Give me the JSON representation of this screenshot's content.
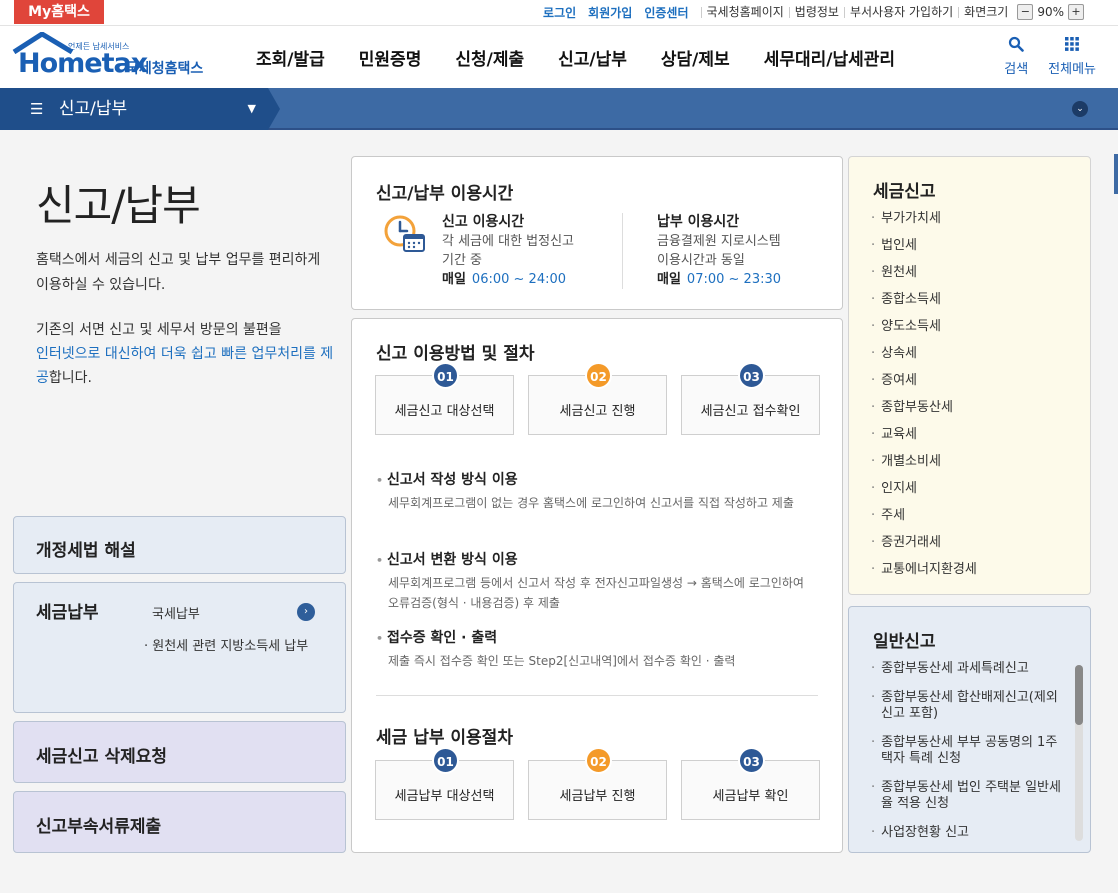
{
  "topbar": {
    "my_tab": "My홈택스",
    "login": "로그인",
    "signup": "회원가입",
    "cert_center": "인증센터",
    "links": [
      "국세청홈페이지",
      "법령정보",
      "부서사용자 가입하기"
    ],
    "zoom_label": "화면크기",
    "zoom_minus": "−",
    "zoom_value": "90%",
    "zoom_plus": "+"
  },
  "header": {
    "logo_sub": "언제든 납세서비스",
    "logo_main": "Hometax",
    "logo_kor": "국세청홈택스",
    "nav": [
      "조회/발급",
      "민원증명",
      "신청/제출",
      "신고/납부",
      "상담/제보",
      "세무대리/납세관리"
    ],
    "search_label": "검색",
    "allmenu_label": "전체메뉴"
  },
  "location": {
    "current": "신고/납부"
  },
  "left": {
    "title": "신고/납부",
    "intro1": "홈택스에서 세금의 신고 및 납부 업무를 편리하게 이용하실 수 있습니다.",
    "intro2_pre": "기존의 서면 신고 및 세무서 방문의 불편을",
    "intro2_hl": "인터넷으로 대신하여 더욱 쉽고 빠른 업무처리를 제공",
    "intro2_post": "합니다.",
    "box1": "개정세법 해설",
    "box2": {
      "title": "세금납부",
      "item1": "국세납부",
      "item2": "원천세 관련 지방소득세 납부"
    },
    "box3": "세금신고 삭제요청",
    "box4": "신고부속서류제출"
  },
  "hours": {
    "title": "신고/납부 이용시간",
    "report": {
      "head": "신고 이용시간",
      "desc1": "각 세금에 대한 법정신고",
      "desc2": "기간 중",
      "day": "매일",
      "time": "06:00 ~ 24:00"
    },
    "pay": {
      "head": "납부 이용시간",
      "desc1": "금융결제원 지로시스템",
      "desc2": "이용시간과 동일",
      "day": "매일",
      "time": "07:00 ~ 23:30"
    }
  },
  "procedure": {
    "title": "신고 이용방법 및 절차",
    "steps": [
      {
        "num": "01",
        "label": "세금신고 대상선택"
      },
      {
        "num": "02",
        "label": "세금신고 진행"
      },
      {
        "num": "03",
        "label": "세금신고 접수확인"
      }
    ],
    "methods": [
      {
        "head": "신고서 작성 방식 이용",
        "desc": "세무회계프로그램이 없는 경우 홈택스에 로그인하여 신고서를 직접 작성하고 제출"
      },
      {
        "head": "신고서 변환 방식 이용",
        "desc": "세무회계프로그램 등에서 신고서 작성 후 전자신고파일생성 → 홈택스에 로그인하여 오류검증(형식 · 내용검증) 후 제출"
      },
      {
        "head": "접수증 확인 · 출력",
        "desc": "제출 즉시 접수증 확인 또는 Step2[신고내역]에서 접수증 확인 · 출력"
      }
    ]
  },
  "payment": {
    "title": "세금 납부 이용절차",
    "steps": [
      {
        "num": "01",
        "label": "세금납부 대상선택"
      },
      {
        "num": "02",
        "label": "세금납부 진행"
      },
      {
        "num": "03",
        "label": "세금납부 확인"
      }
    ]
  },
  "tax_report": {
    "title": "세금신고",
    "items": [
      "부가가치세",
      "법인세",
      "원천세",
      "종합소득세",
      "양도소득세",
      "상속세",
      "증여세",
      "종합부동산세",
      "교육세",
      "개별소비세",
      "인지세",
      "주세",
      "증권거래세",
      "교통에너지환경세"
    ]
  },
  "general_report": {
    "title": "일반신고",
    "items": [
      "종합부동산세 과세특례신고",
      "종합부동산세 합산배제신고(제외신고 포함)",
      "종합부동산세 부부 공동명의 1주택자 특례 신청",
      "종합부동산세 법인 주택분 일반세율 적용 신청",
      "사업장현황 신고"
    ]
  },
  "colors": {
    "brand_blue": "#1a5fb4",
    "nav_bar": "#3d6aa4",
    "step_blue": "#2e5996",
    "step_orange": "#f49a29",
    "my_tab": "#e0453a"
  }
}
